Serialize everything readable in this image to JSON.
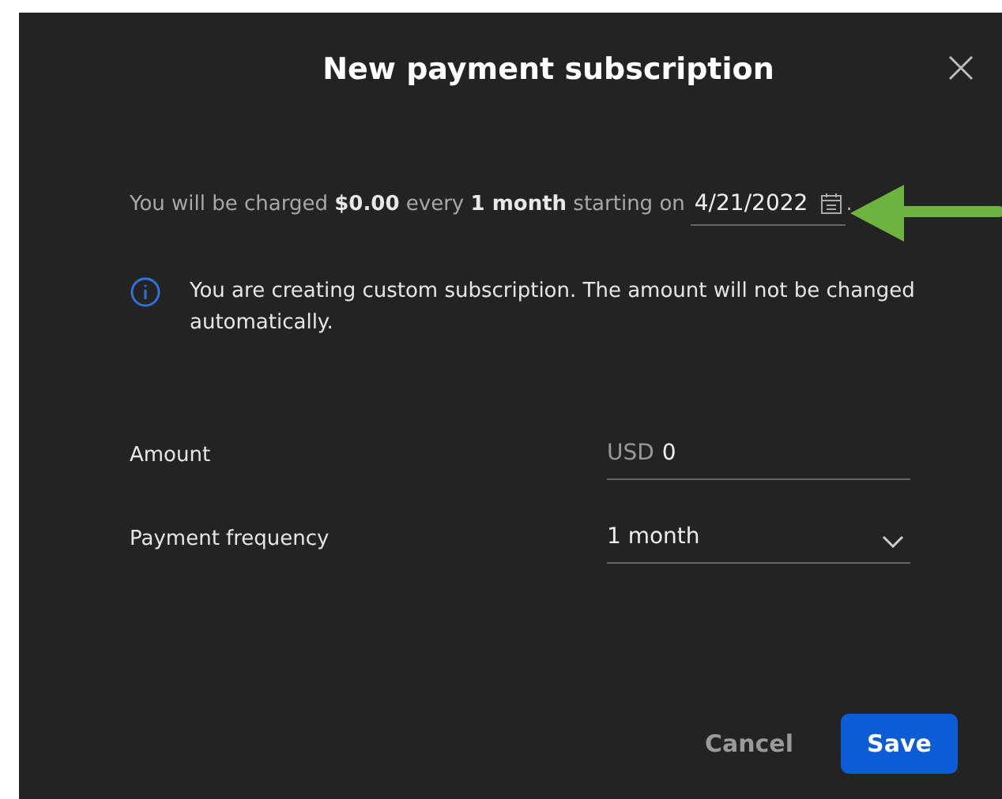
{
  "dialog": {
    "title": "New payment subscription"
  },
  "summary": {
    "text": "You will be charged **$0.00** every **1 month** starting on",
    "date": "4/21/2022",
    "end": "."
  },
  "notice": {
    "text": "You are creating custom subscription. The amount will not be changed automatically."
  },
  "fields": [
    {
      "kind": "amount",
      "label": "Amount",
      "prefix": "USD",
      "value": "0"
    },
    {
      "kind": "select",
      "label": "Payment frequency",
      "value": "1 month"
    }
  ],
  "buttons": [
    {
      "kind": "text",
      "label": "Cancel"
    },
    {
      "kind": "primary",
      "label": "Save"
    }
  ]
}
